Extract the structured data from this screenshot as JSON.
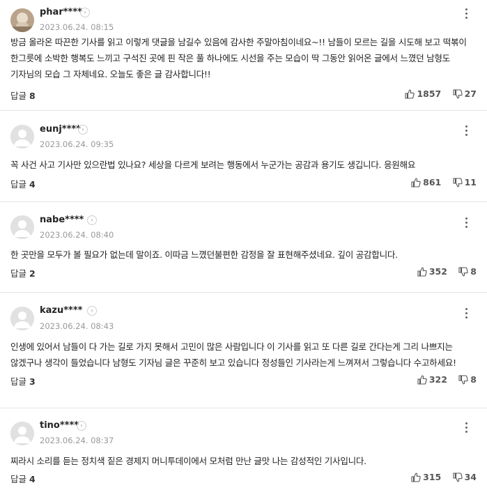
{
  "reply_label": "답글",
  "comments": [
    {
      "nickname": "phar****",
      "date": "2023.06.24. 08:15",
      "text": "방금 올라온 따끈한 기사를 읽고 이렇게 댓글을 남길수 있음에 감사한 주말아침이네요~!! 남들이 모르는 길을 시도해 보고 떡볶이 한그릇에 소박한 행복도 느끼고 구석진 곳에 핀 작은 풀 하나에도 시선을 주는 모습이 딱 그동안 읽어온 글에서 느꼈던 남형도 기자님의 모습 그 자체네요. 오늘도 좋은 글 감사합니다!!",
      "replies": "8",
      "likes": "1857",
      "dislikes": "27",
      "avatar": "photo"
    },
    {
      "nickname": "eunj****",
      "date": "2023.06.24. 09:35",
      "text": "꼭 사건 사고 기사만 있으란법 있나요? 세상을 다르게 보려는 행동에서 누군가는 공감과 용기도 생깁니다. 응원해요",
      "replies": "4",
      "likes": "861",
      "dislikes": "11",
      "avatar": "default"
    },
    {
      "nickname": "nabe****",
      "date": "2023.06.24. 08:40",
      "text": "한 곳만을 모두가 볼 필요가 없는데 말이죠. 이따금 느꼈던불편한 감정을 잘 표현해주셨네요. 깊이 공감합니다.",
      "replies": "2",
      "likes": "352",
      "dislikes": "8",
      "avatar": "default"
    },
    {
      "nickname": "kazu****",
      "date": "2023.06.24. 08:43",
      "text": "인생에 있어서 남들이 다 가는 길로 가지 못해서 고민이 많은 사람입니다 이 기사를 읽고 또 다른 길로 간다는게 그리 나쁘지는 않겠구나 생각이 들었습니다 남형도 기자님 글은 꾸준히 보고 있습니다 정성들인 기사라는게 느껴져서 그렇습니다 수고하세요!",
      "replies": "3",
      "likes": "322",
      "dislikes": "8",
      "avatar": "default"
    },
    {
      "nickname": "tino****",
      "date": "2023.06.24. 08:37",
      "text": "찌라시 소리를 듣는 정치색 짙은 경제지 머니투데이에서 모처럼 만난 글맛 나는 감성적인 기사입니다.",
      "replies": "4",
      "likes": "315",
      "dislikes": "34",
      "avatar": "default"
    }
  ]
}
